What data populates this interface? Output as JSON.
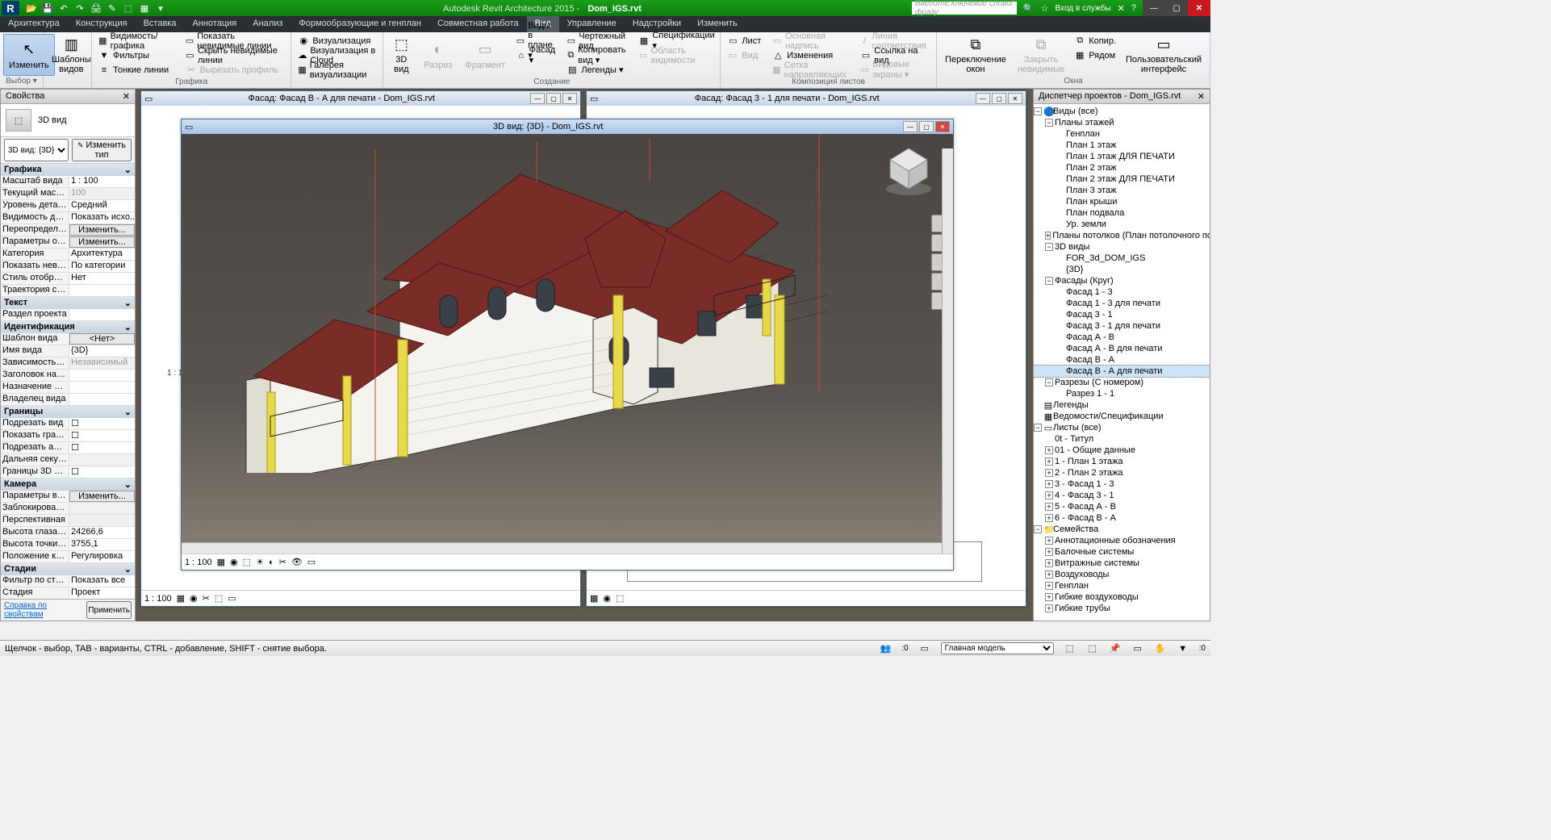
{
  "app": {
    "title_prefix": "Autodesk Revit Architecture 2015 -",
    "document": "Dom_IGS.rvt",
    "search_placeholder": "Введите ключевое слово/фразу",
    "login_label": "Вход в службы"
  },
  "menubar": {
    "items": [
      "Архитектура",
      "Конструкция",
      "Вставка",
      "Аннотация",
      "Анализ",
      "Формообразующие и генплан",
      "Совместная работа",
      "Вид",
      "Управление",
      "Надстройки",
      "Изменить"
    ],
    "active": "Вид"
  },
  "ribbon": {
    "group1": {
      "label": "Выбор ▾",
      "modify": "Изменить",
      "templates": "Шаблоны\nвидов"
    },
    "group2": {
      "label": "Графика",
      "visibility": "Видимость/ графика",
      "filters": "Фильтры",
      "thin": "Тонкие линии",
      "show_hidden": "Показать невидимые линии",
      "hide_hidden": "Скрыть невидимые линии",
      "cut_profile": "Вырезать профиль"
    },
    "group3": {
      "viz": "Визуализация",
      "viz_cloud": "Визуализация в Cloud",
      "gallery": "Галерея визуализации"
    },
    "group4": {
      "label": "Создание",
      "view3d": "3D\nвид",
      "section": "Разрез",
      "fragment": "Фрагмент",
      "plan_views": "Виды в плане ▾",
      "facade": "Фасад ▾",
      "drafting": "Чертежный вид",
      "copy_view": "Копировать вид ▾",
      "legends": "Легенды ▾",
      "schedules": "Спецификации ▾",
      "scope": "Область видимости"
    },
    "group5": {
      "label": "Композиция листов",
      "sheet": "Лист",
      "view": "Вид",
      "title": "Основная надпись",
      "revisions": "Изменения",
      "grid": "Сетка направляющих",
      "match": "Линия соответствия",
      "viewref": "Ссылка на вид",
      "viewports": "Видовые экраны ▾"
    },
    "group6": {
      "label": "Окна",
      "switch": "Переключение\nокон",
      "close_hidden": "Закрыть\nневидимые",
      "dup": "Копир.",
      "tile": "Рядом",
      "ui": "Пользовательский\nинтерфейс"
    }
  },
  "properties": {
    "panel_title": "Свойства",
    "type_name": "3D вид",
    "selector": "3D вид: {3D}",
    "edit_type": "Изменить тип",
    "sections": {
      "graphics": {
        "title": "Графика",
        "rows": [
          [
            "Масштаб вида",
            "1 : 100"
          ],
          [
            "Текущий масшт...",
            "100"
          ],
          [
            "Уровень детали...",
            "Средний"
          ],
          [
            "Видимость дета...",
            "Показать исхо..."
          ],
          [
            "Переопределен...",
            "Изменить..."
          ],
          [
            "Параметры ото...",
            "Изменить..."
          ],
          [
            "Категория",
            "Архитектура"
          ],
          [
            "Показать невид...",
            "По категории"
          ],
          [
            "Стиль отображе...",
            "Нет"
          ],
          [
            "Траектория сол...",
            ""
          ]
        ]
      },
      "text": {
        "title": "Текст",
        "rows": [
          [
            "Раздел проекта",
            ""
          ]
        ]
      },
      "ident": {
        "title": "Идентификация",
        "rows": [
          [
            "Шаблон вида",
            "<Нет>"
          ],
          [
            "Имя вида",
            "{3D}"
          ],
          [
            "Зависимость ур...",
            "Независимый"
          ],
          [
            "Заголовок на л...",
            ""
          ],
          [
            "Назначение вида",
            ""
          ],
          [
            "Владелец вида",
            ""
          ]
        ]
      },
      "bounds": {
        "title": "Границы",
        "rows": [
          [
            "Подрезать вид",
            "☐"
          ],
          [
            "Показать грани...",
            "☐"
          ],
          [
            "Подрезать анно...",
            "☐"
          ],
          [
            "Дальняя секуща...",
            ""
          ],
          [
            "Границы 3D вида",
            "☐"
          ]
        ]
      },
      "camera": {
        "title": "Камера",
        "rows": [
          [
            "Параметры виз...",
            "Изменить..."
          ],
          [
            "Заблокированн...",
            ""
          ],
          [
            "Перспективная",
            ""
          ],
          [
            "Высота глаза на...",
            "24266,6"
          ],
          [
            "Высота точки ц...",
            "3755,1"
          ],
          [
            "Положение кам...",
            "Регулировка"
          ]
        ]
      },
      "stages": {
        "title": "Стадии",
        "rows": [
          [
            "Фильтр по стад...",
            "Показать все"
          ],
          [
            "Стадия",
            "Проект"
          ]
        ]
      }
    },
    "help_link": "Справка по свойствам",
    "apply": "Применить"
  },
  "mdi": {
    "win1": {
      "title": "Фасад: Фасад В - А для печати - Dom_IGS.rvt",
      "scale": "1 : 100"
    },
    "win2": {
      "title": "Фасад: Фасад 3 - 1 для печати - Dom_IGS.rvt"
    },
    "win3": {
      "title": "3D вид: {3D} - Dom_IGS.rvt",
      "scale": "1 : 100"
    },
    "bottom_scale": "1 : 100"
  },
  "browser": {
    "title": "Диспетчер проектов - Dom_IGS.rvt",
    "views_root": "Виды (все)",
    "plans": {
      "title": "Планы этажей",
      "items": [
        "Генплан",
        "План 1 этаж",
        "План 1 этаж ДЛЯ ПЕЧАТИ",
        "План 2 этаж",
        "План 2 этаж ДЛЯ ПЕЧАТИ",
        "План 3 этаж",
        "План крыши",
        "План подвала",
        "Ур. земли"
      ]
    },
    "ceiling": "Планы потолков (План потолочного покр",
    "views3d": {
      "title": "3D виды",
      "items": [
        "FOR_3d_DOM_IGS",
        "{3D}"
      ]
    },
    "facades": {
      "title": "Фасады (Круг)",
      "items": [
        "Фасад 1 - 3",
        "Фасад 1 - 3 для печати",
        "Фасад 3 - 1",
        "Фасад 3 - 1 для печати",
        "Фасад А - В",
        "Фасад А - В для печати",
        "Фасад В - А",
        "Фасад В - А для печати"
      ]
    },
    "sections": {
      "title": "Разрезы (С номером)",
      "items": [
        "Разрез 1 - 1"
      ]
    },
    "legends": "Легенды",
    "schedules": "Ведомости/Спецификации",
    "sheets": {
      "title": "Листы (все)",
      "items": [
        "0t - Титул",
        "01 - Общие данные",
        "1 - План 1 этажа",
        "2 - План 2 этажа",
        "3 - Фасад 1 - 3",
        "4 - Фасад 3 - 1",
        "5 - Фасад А - В",
        "6 - Фасад В - А"
      ]
    },
    "families": {
      "title": "Семейства",
      "items": [
        "Аннотационные обозначения",
        "Балочные системы",
        "Витражные системы",
        "Воздуховоды",
        "Генплан",
        "Гибкие воздуховоды",
        "Гибкие трубы"
      ]
    }
  },
  "status": {
    "hint": "Щелчок - выбор, TAB - варианты, CTRL - добавление, SHIFT - снятие выбора.",
    "model": "Главная модель"
  }
}
